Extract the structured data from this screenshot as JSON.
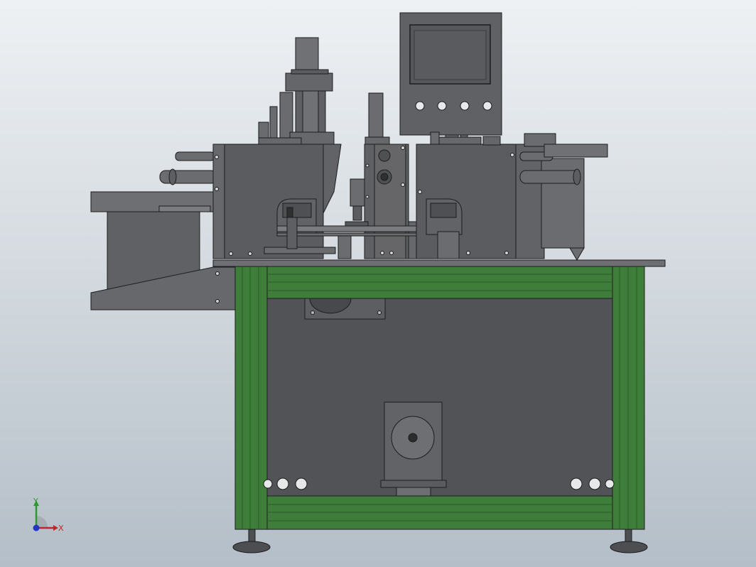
{
  "view": {
    "background_top": "#eef1f4",
    "background_bottom": "#b4bec8"
  },
  "colors": {
    "machine_body": "#5a5c5f",
    "machine_body_light": "#707275",
    "frame_green": "#3e7d3a",
    "frame_green_dark": "#2c5c29",
    "edge": "#1c1d1e",
    "screen": "#55575a"
  },
  "triad": {
    "x_label": "X",
    "y_label": "Y",
    "x_color": "#c42424",
    "y_color": "#2c9a2c",
    "z_color": "#2434c4"
  }
}
